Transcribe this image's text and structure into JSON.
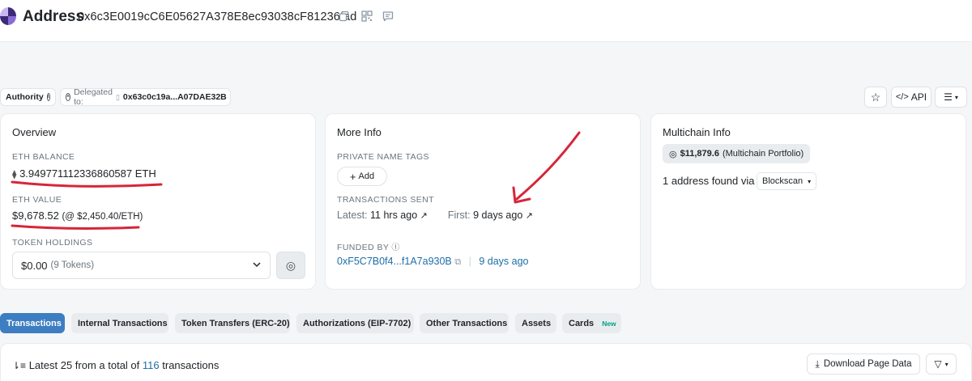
{
  "header": {
    "title": "Address",
    "address": "0x6c3E0019cC6E05627A378E8ec93038cF81236fad",
    "icons": [
      "copy-icon",
      "qr-code-icon",
      "comment-icon"
    ]
  },
  "tags": {
    "authority_label": "Authority",
    "delegated_label": "Delegated to:",
    "delegated_address": "0x63c0c19a...A07DAE32B"
  },
  "actions": {
    "api_label": "API",
    "icons": [
      "star-icon",
      "code-icon",
      "list-menu-icon"
    ]
  },
  "overview": {
    "title": "Overview",
    "eth_balance_label": "ETH BALANCE",
    "eth_balance_value": "3.949771112336860587 ETH",
    "eth_value_label": "ETH VALUE",
    "eth_value_amount": "$9,678.52",
    "eth_value_rate": "(@ $2,450.40/ETH)",
    "token_holdings_label": "TOKEN HOLDINGS",
    "token_value": "$0.00",
    "token_count": "(9 Tokens)"
  },
  "more_info": {
    "title": "More Info",
    "private_tags_label": "PRIVATE NAME TAGS",
    "add_label": "Add",
    "tx_sent_label": "TRANSACTIONS SENT",
    "latest_label": "Latest:",
    "latest_value": "11 hrs ago",
    "first_label": "First:",
    "first_value": "9 days ago",
    "funded_by_label": "FUNDED BY",
    "funded_by_address": "0xF5C7B0f4...f1A7a930B",
    "funded_by_age": "9 days ago"
  },
  "multichain": {
    "title": "Multichain Info",
    "portfolio_value": "$11,879.6",
    "portfolio_label": "(Multichain Portfolio)",
    "found_text": "1 address found via",
    "source": "Blockscan"
  },
  "tabs": [
    {
      "label": "Transactions",
      "active": true
    },
    {
      "label": "Internal Transactions",
      "active": false
    },
    {
      "label": "Token Transfers (ERC-20)",
      "active": false
    },
    {
      "label": "Authorizations (EIP-7702)",
      "active": false
    },
    {
      "label": "Other Transactions",
      "active": false
    },
    {
      "label": "Assets",
      "active": false
    },
    {
      "label": "Cards",
      "badge": "New",
      "active": false
    }
  ],
  "transactions": {
    "prefix": "Latest 25 from a total of",
    "total": "116",
    "suffix": "transactions",
    "download_label": "Download Page Data"
  },
  "colors": {
    "accent": "#3d7ec2",
    "link": "#1e6ea7",
    "annotation_red": "#d6263a",
    "badge_green": "#00a186"
  }
}
